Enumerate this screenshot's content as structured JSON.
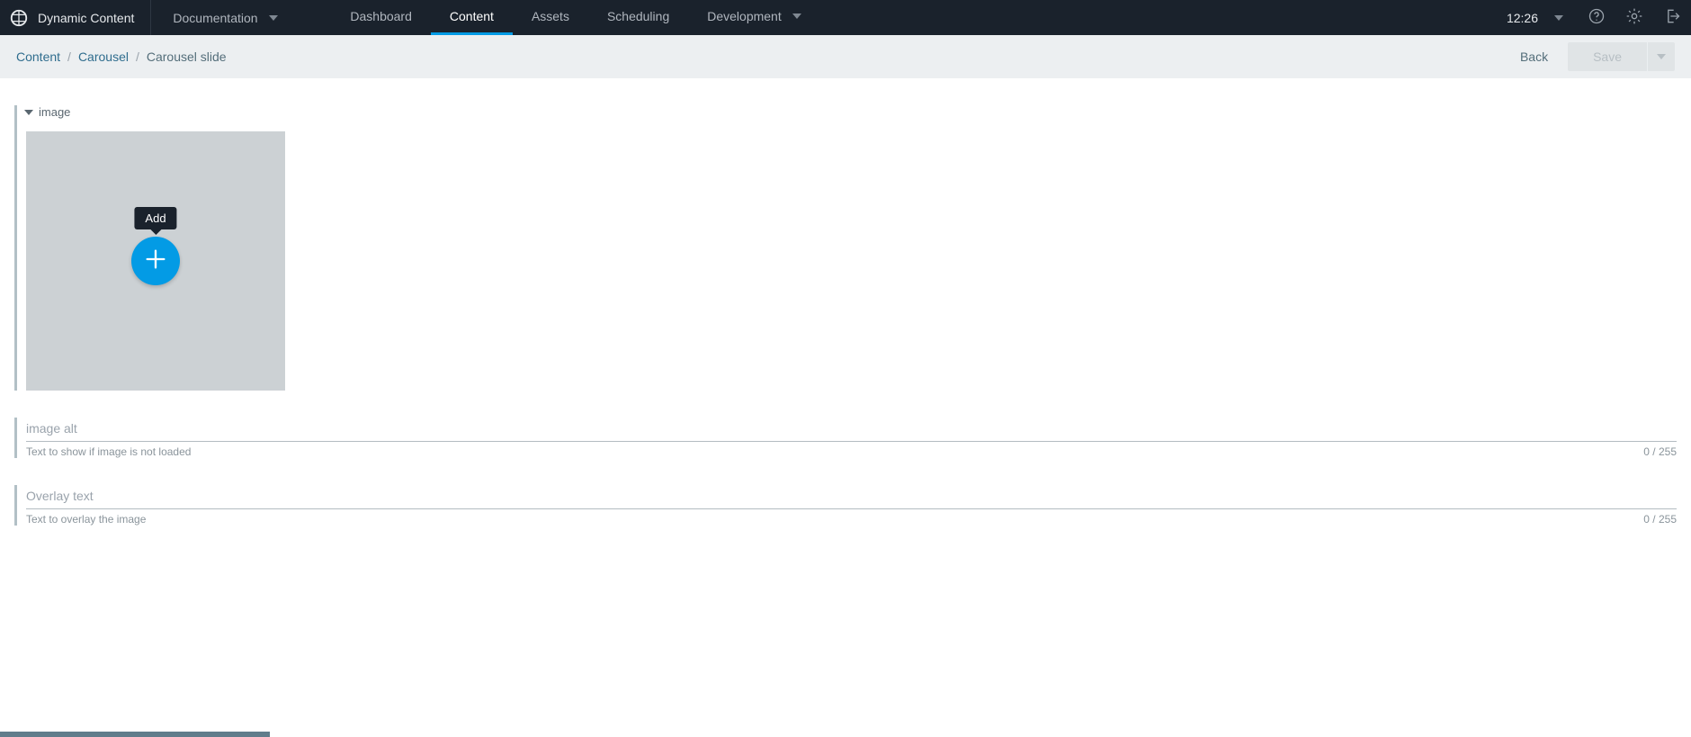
{
  "brand": {
    "name": "Dynamic Content"
  },
  "hub": {
    "selected": "Documentation"
  },
  "nav": {
    "items": [
      {
        "label": "Dashboard",
        "active": false
      },
      {
        "label": "Content",
        "active": true
      },
      {
        "label": "Assets",
        "active": false
      },
      {
        "label": "Scheduling",
        "active": false
      },
      {
        "label": "Development",
        "active": false,
        "caret": true
      }
    ]
  },
  "clock": {
    "time": "12:26"
  },
  "breadcrumbs": {
    "items": [
      {
        "label": "Content",
        "link": true
      },
      {
        "label": "Carousel",
        "link": true
      },
      {
        "label": "Carousel slide",
        "link": false
      }
    ],
    "back": "Back",
    "save": "Save"
  },
  "editor": {
    "image_section": {
      "title": "image",
      "add_tooltip": "Add"
    },
    "fields": [
      {
        "placeholder": "image alt",
        "hint": "Text to show if image is not loaded",
        "value": "",
        "count": "0",
        "max": "255"
      },
      {
        "placeholder": "Overlay text",
        "hint": "Text to overlay the image",
        "value": "",
        "count": "0",
        "max": "255"
      }
    ]
  }
}
